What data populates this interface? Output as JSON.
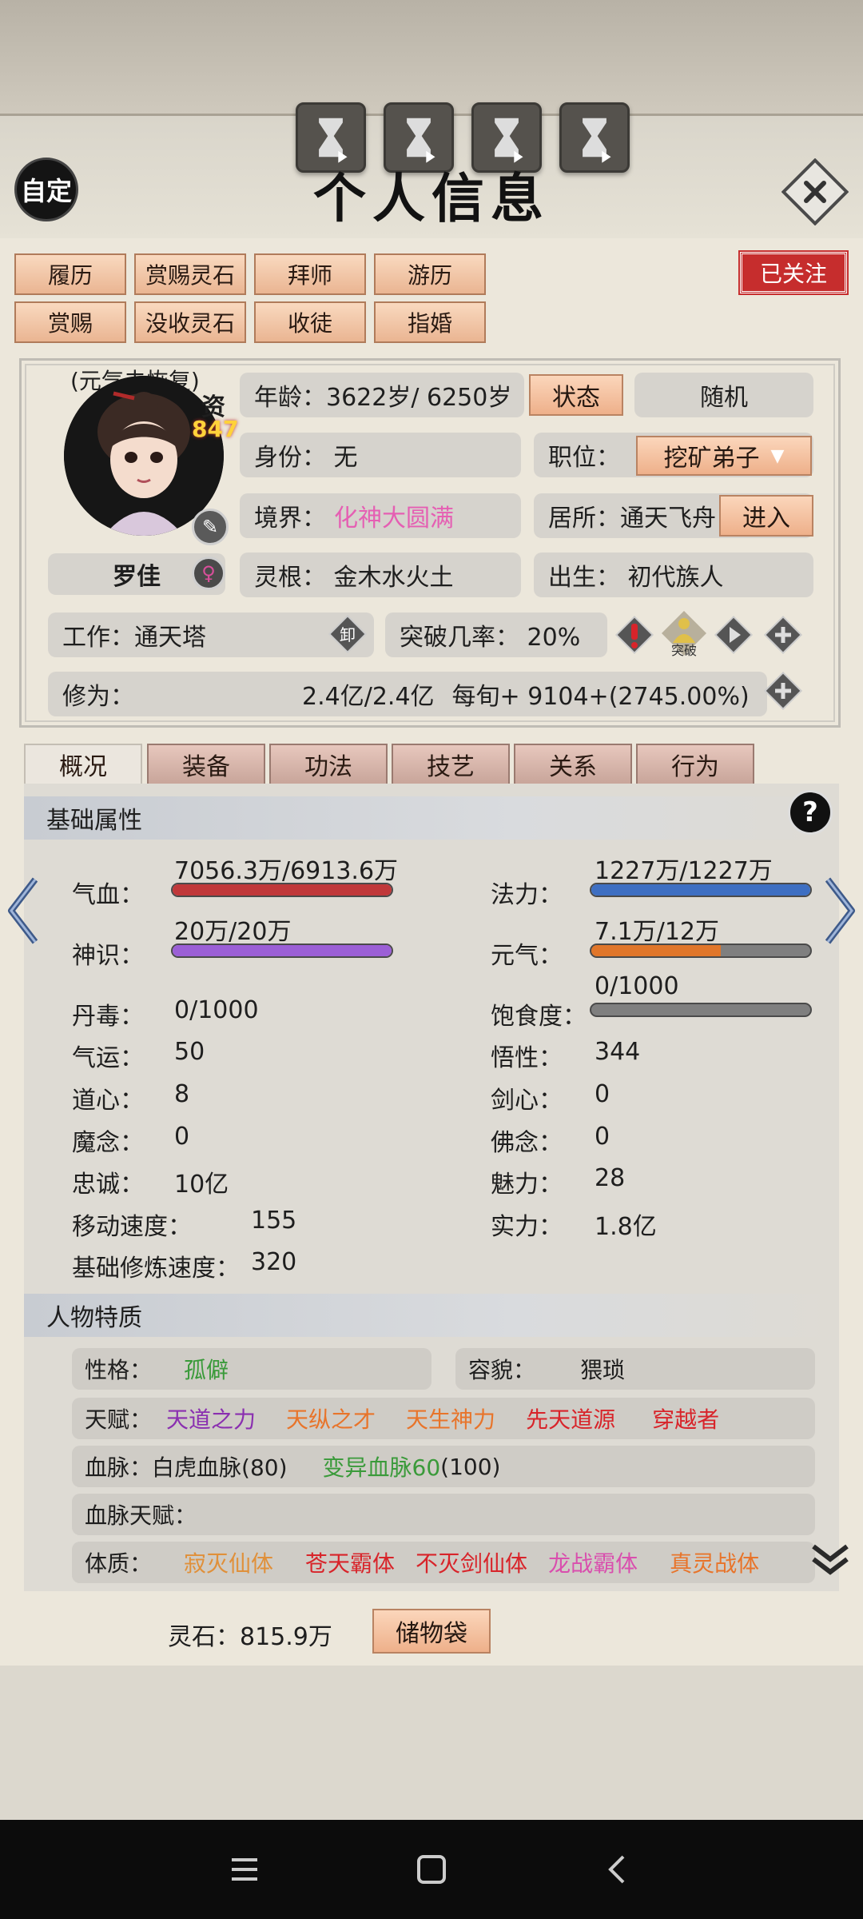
{
  "header": {
    "title": "个人信息",
    "auto_label": "自定",
    "hourglass_buttons": [
      "hourglass-icon",
      "hourglass-icon",
      "hourglass-icon",
      "hourglass-icon"
    ],
    "followed_label": "已关注"
  },
  "actions": {
    "row1": [
      "履历",
      "赏赐灵石",
      "拜师",
      "游历"
    ],
    "row2": [
      "赏赐",
      "没收灵石",
      "收徒",
      "指婚"
    ]
  },
  "profile": {
    "status_note": "(元气未恢复)",
    "aptitude_label": "资",
    "aptitude_value": "847",
    "name": "罗佳",
    "gender_icon": "female-icon",
    "age_text": "年龄：3622岁/ 6250岁",
    "status_button": "状态",
    "random_button": "随机",
    "identity_text": "身份：  无",
    "position_label": "职位：",
    "position_value": "挖矿弟子",
    "realm_label": "境界：",
    "realm_value": "化神大圆满",
    "residence_text": "居所：通天飞舟",
    "enter_button": "进入",
    "root_text": "灵根：  金木水火土",
    "birth_text": "出生：  初代族人",
    "work_text": "工作：通天塔",
    "unload_label": "卸",
    "breakthrough_text": "突破几率：  20%",
    "breakthrough_icon_label": "突破",
    "cultivation_label": "修为：",
    "cultivation_value": "2.4亿/2.4亿",
    "per_turn_text": "每旬+   9104+(2745.00%)"
  },
  "tabs": [
    "概况",
    "装备",
    "功法",
    "技艺",
    "关系",
    "行为"
  ],
  "active_tab": "概况",
  "basic": {
    "heading": "基础属性",
    "help_label": "?",
    "hp_label": "气血：",
    "hp_value": "7056.3万/6913.6万",
    "hp_fill": 1.0,
    "mana_label": "法力：",
    "mana_value": "1227万/1227万",
    "mana_fill": 1.0,
    "sense_label": "神识：",
    "sense_value": "20万/20万",
    "sense_fill": 1.0,
    "vigor_label": "元气：",
    "vigor_value": "7.1万/12万",
    "vigor_fill": 0.59,
    "satiety_label": "饱食度：",
    "satiety_value": "0/1000",
    "satiety_fill": 0.0,
    "stats_left": [
      {
        "label": "丹毒：",
        "value": "0/1000"
      },
      {
        "label": "气运：",
        "value": "50"
      },
      {
        "label": "道心：",
        "value": "8"
      },
      {
        "label": "魔念：",
        "value": "0"
      },
      {
        "label": "忠诚：",
        "value": "10亿"
      },
      {
        "label": "移动速度：",
        "value": "155"
      },
      {
        "label": "基础修炼速度：",
        "value": "320"
      }
    ],
    "stats_right": [
      {
        "label": "悟性：",
        "value": "344"
      },
      {
        "label": "剑心：",
        "value": "0"
      },
      {
        "label": "佛念：",
        "value": "0"
      },
      {
        "label": "魅力：",
        "value": "28"
      },
      {
        "label": "实力：",
        "value": "1.8亿"
      }
    ]
  },
  "traits": {
    "heading": "人物特质",
    "personality_label": "性格：",
    "personality_value": "孤僻",
    "looks_label": "容貌：",
    "looks_value": "猥琐",
    "talent_label": "天赋：",
    "talents": [
      {
        "text": "天道之力",
        "color": "#8a2fb0"
      },
      {
        "text": "天纵之才",
        "color": "#e8742a"
      },
      {
        "text": "天生神力",
        "color": "#e8742a"
      },
      {
        "text": "先天道源",
        "color": "#d8242a"
      },
      {
        "text": "穿越者",
        "color": "#d8242a"
      }
    ],
    "bloodline_label": "血脉：",
    "bloodline_1": "白虎血脉(80)",
    "bloodline_2_name": "变异血脉60",
    "bloodline_2_rest": "(100)",
    "bloodline_talent_label": "血脉天赋：",
    "physique_label": "体质：",
    "physiques": [
      {
        "text": "寂灭仙体",
        "color": "#e0903a"
      },
      {
        "text": "苍天霸体",
        "color": "#d8242a"
      },
      {
        "text": "不灭剑仙体",
        "color": "#d8242a"
      },
      {
        "text": "龙战霸体",
        "color": "#d94fae"
      },
      {
        "text": "真灵战体",
        "color": "#e8742a"
      }
    ]
  },
  "footer": {
    "spirit_stone_text": "灵石：815.9万",
    "storage_button": "储物袋"
  },
  "colors": {
    "hp": "#c0383a",
    "mana": "#3e6fc2",
    "sense": "#9b5fd6",
    "vigor": "#e0762a",
    "realm": "#e55fb3",
    "green": "#3a9a3a"
  },
  "system_nav": [
    "menu-icon",
    "home-icon",
    "back-icon"
  ]
}
